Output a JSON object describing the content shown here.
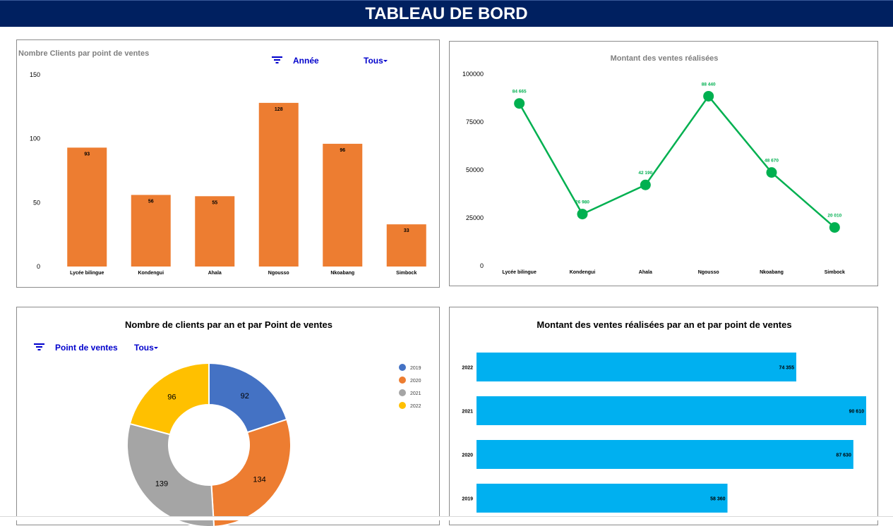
{
  "header": {
    "title": "TABLEAU DE BORD"
  },
  "colors": {
    "header_bg": "#002060",
    "bar_orange": "#ED7D31",
    "line_green": "#00B050",
    "bar_blue": "#00B0F0",
    "slicer_blue": "#0000CC",
    "pie_2019": "#4472C4",
    "pie_2020": "#ED7D31",
    "pie_2021": "#A5A5A5",
    "pie_2022": "#FFC000"
  },
  "slicer1": {
    "label": "Année",
    "value": "Tous",
    "icon": "filter-icon"
  },
  "slicer2": {
    "label": "Point de ventes",
    "value": "Tous",
    "icon": "filter-icon"
  },
  "chart_data": [
    {
      "type": "bar",
      "title": "Nombre Clients par point de ventes",
      "categories": [
        "Lycée bilingue",
        "Kondengui",
        "Ahala",
        "Ngousso",
        "Nkoabang",
        "Simbock"
      ],
      "values": [
        93,
        56,
        55,
        128,
        96,
        33
      ],
      "data_labels": [
        "93",
        "56",
        "55",
        "128",
        "96",
        "33"
      ],
      "yticks": [
        "0",
        "50",
        "100",
        "150"
      ],
      "ylim": [
        0,
        150
      ],
      "grid": false
    },
    {
      "type": "line",
      "title": "Montant des ventes réalisées",
      "categories": [
        "Lycée bilingue",
        "Kondengui",
        "Ahala",
        "Ngousso",
        "Nkoabang",
        "Simbock"
      ],
      "values": [
        84665,
        26980,
        42190,
        88440,
        48670,
        20010
      ],
      "data_labels": [
        "84 665",
        "26 980",
        "42 190",
        "88 440",
        "48 670",
        "20 010"
      ],
      "yticks": [
        "0",
        "25000",
        "50000",
        "75000",
        "100000"
      ],
      "ylim": [
        0,
        100000
      ],
      "grid": false
    },
    {
      "type": "pie",
      "title": "Nombre de clients par an et par Point de ventes",
      "donut": true,
      "labels": [
        "2019",
        "2020",
        "2021",
        "2022"
      ],
      "values": [
        92,
        134,
        139,
        96
      ],
      "data_labels": [
        "92",
        "134",
        "139",
        "96"
      ],
      "legend": "right"
    },
    {
      "type": "bar",
      "orientation": "horizontal",
      "title": "Montant des ventes réalisées par an et par point de ventes",
      "categories": [
        "2022",
        "2021",
        "2020",
        "2019"
      ],
      "values": [
        74355,
        90610,
        87630,
        58360
      ],
      "data_labels": [
        "74 355",
        "90 610",
        "87 630",
        "58 360"
      ],
      "grid": false
    }
  ]
}
